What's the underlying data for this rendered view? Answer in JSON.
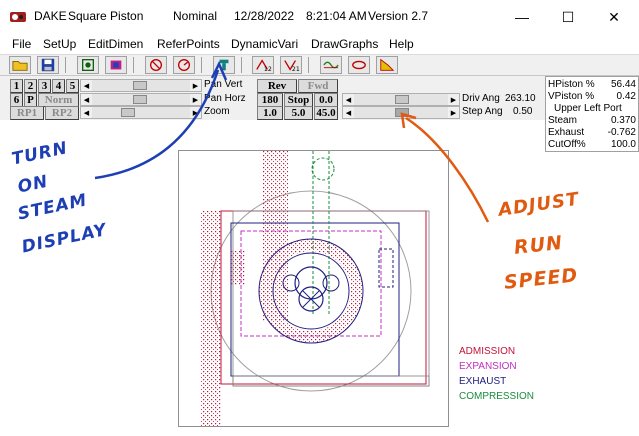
{
  "window": {
    "app_name": "DAKE",
    "doc_name": "Square Piston",
    "mode": "Nominal",
    "date": "12/28/2022",
    "time": "8:21:04 AM",
    "version": "Version 2.7",
    "minimize": "—",
    "maximize": "☐",
    "close": "✕"
  },
  "menu": [
    "File",
    "SetUp",
    "EditDimen",
    "ReferPoints",
    "DynamicVari",
    "DrawGraphs",
    "Help"
  ],
  "panel": {
    "keys_row1": [
      "1",
      "2",
      "3",
      "4",
      "5"
    ],
    "keys_row2_a": "6",
    "keys_row2_b": "P",
    "norm": "Norm",
    "rp1": "RP1",
    "rp2": "RP2",
    "pan_vert": "Pan Vert",
    "pan_horz": "Pan Horz",
    "zoom": "Zoom",
    "rev": "Rev",
    "fwd": "Fwd",
    "k180": "180",
    "stop": "Stop",
    "k00": "0.0",
    "k10": "1.0",
    "k50": "5.0",
    "k450": "45.0",
    "driv_ang_label": "Driv Ang",
    "driv_ang_value": "263.10",
    "step_ang_label": "Step Ang",
    "step_ang_value": "0.50"
  },
  "readout": {
    "hpiston_label": "HPiston %",
    "hpiston_value": "56.44",
    "vpiston_label": "VPiston %",
    "vpiston_value": "0.42",
    "port_label": "Upper Left Port",
    "steam_label": "Steam",
    "steam_value": "0.370",
    "exhaust_label": "Exhaust",
    "exhaust_value": "-0.762",
    "cutoff_label": "CutOff%",
    "cutoff_value": "100.0"
  },
  "legend": [
    {
      "label": "ADMISSION",
      "color": "#c0143c"
    },
    {
      "label": "EXPANSION",
      "color": "#c030c0"
    },
    {
      "label": "EXHAUST",
      "color": "#202080"
    },
    {
      "label": "COMPRESSION",
      "color": "#1a8c3a"
    }
  ],
  "annotations": {
    "left_lines": [
      "TURN",
      "ON",
      "STEAM",
      "DISPLAY"
    ],
    "right_lines": [
      "ADJUST",
      "RUN",
      "SPEED"
    ],
    "left_color": "#1e3fb4",
    "right_color": "#e05a10"
  }
}
